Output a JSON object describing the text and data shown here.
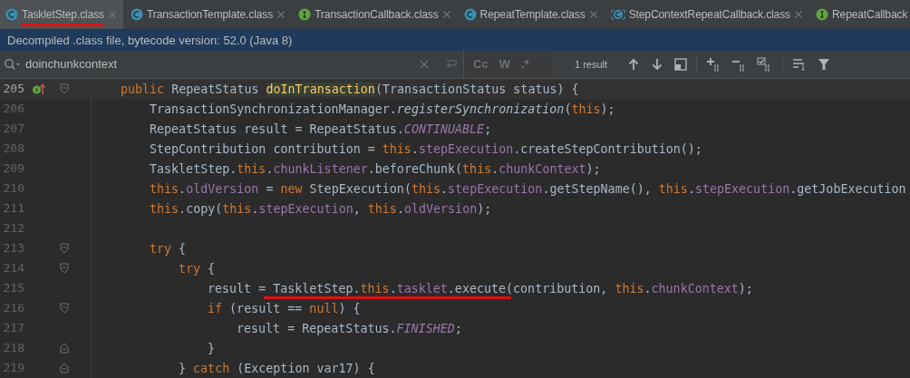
{
  "tabs": [
    {
      "label": "TaskletStep.class",
      "kind": "class",
      "selected": true,
      "marked": true,
      "closable": true
    },
    {
      "label": "TransactionTemplate.class",
      "kind": "class",
      "selected": false,
      "marked": false,
      "closable": true
    },
    {
      "label": "TransactionCallback.class",
      "kind": "interface",
      "selected": false,
      "marked": false,
      "closable": true
    },
    {
      "label": "RepeatTemplate.class",
      "kind": "class",
      "selected": false,
      "marked": false,
      "closable": true
    },
    {
      "label": "StepContextRepeatCallback.class",
      "kind": "bracketed",
      "selected": false,
      "marked": false,
      "closable": true
    },
    {
      "label": "RepeatCallback",
      "kind": "interface",
      "selected": false,
      "marked": false,
      "closable": false
    }
  ],
  "banner": "Decompiled .class file, bytecode version: 52.0 (Java 8)",
  "search": {
    "value": "doinchunkcontext",
    "options": [
      "Cc",
      "W",
      ".*"
    ],
    "result": "1 result"
  },
  "code_lines": [
    {
      "number": "205",
      "current": true,
      "implementation_marker": true,
      "fold_start": true,
      "fold_end": false,
      "tokens": [
        {
          "kind": "keyword",
          "text": "public"
        },
        {
          "kind": "plain",
          "text": " RepeatStatus "
        },
        {
          "kind": "declaration",
          "text": "doInTransaction"
        },
        {
          "kind": "plain",
          "text": "(TransactionStatus status) {"
        }
      ],
      "children": [
        {
          "number": "206",
          "current": false,
          "implementation_marker": false,
          "fold_start": false,
          "fold_end": false,
          "tokens": [
            {
              "kind": "plain",
              "text": "TransactionSynchronizationManager."
            },
            {
              "kind": "static-method",
              "text": "registerSynchronization"
            },
            {
              "kind": "plain",
              "text": "("
            },
            {
              "kind": "keyword",
              "text": "this"
            },
            {
              "kind": "plain",
              "text": ");"
            }
          ]
        },
        {
          "number": "207",
          "current": false,
          "implementation_marker": false,
          "fold_start": false,
          "fold_end": false,
          "tokens": [
            {
              "kind": "plain",
              "text": "RepeatStatus result = RepeatStatus."
            },
            {
              "kind": "static",
              "text": "CONTINUABLE"
            },
            {
              "kind": "plain",
              "text": ";"
            }
          ]
        },
        {
          "number": "208",
          "current": false,
          "implementation_marker": false,
          "fold_start": false,
          "fold_end": false,
          "tokens": [
            {
              "kind": "plain",
              "text": "StepContribution contribution = "
            },
            {
              "kind": "keyword",
              "text": "this"
            },
            {
              "kind": "member",
              "text": ".stepExecution"
            },
            {
              "kind": "plain",
              "text": ".createStepContribution();"
            }
          ]
        },
        {
          "number": "209",
          "current": false,
          "implementation_marker": false,
          "fold_start": false,
          "fold_end": false,
          "tokens": [
            {
              "kind": "plain",
              "text": "TaskletStep."
            },
            {
              "kind": "keyword",
              "text": "this"
            },
            {
              "kind": "member",
              "text": ".chunkListener"
            },
            {
              "kind": "plain",
              "text": ".beforeChunk("
            },
            {
              "kind": "keyword",
              "text": "this"
            },
            {
              "kind": "member",
              "text": ".chunkContext"
            },
            {
              "kind": "plain",
              "text": ");"
            }
          ]
        },
        {
          "number": "210",
          "current": false,
          "implementation_marker": false,
          "fold_start": false,
          "fold_end": false,
          "tokens": [
            {
              "kind": "keyword",
              "text": "this"
            },
            {
              "kind": "member",
              "text": ".oldVersion"
            },
            {
              "kind": "plain",
              "text": " = "
            },
            {
              "kind": "keyword",
              "text": "new"
            },
            {
              "kind": "plain",
              "text": " StepExecution("
            },
            {
              "kind": "keyword",
              "text": "this"
            },
            {
              "kind": "member",
              "text": ".stepExecution"
            },
            {
              "kind": "plain",
              "text": ".getStepName(), "
            },
            {
              "kind": "keyword",
              "text": "this"
            },
            {
              "kind": "member",
              "text": ".stepExecution"
            },
            {
              "kind": "plain",
              "text": ".getJobExecution"
            }
          ]
        },
        {
          "number": "211",
          "current": false,
          "implementation_marker": false,
          "fold_start": false,
          "fold_end": false,
          "tokens": [
            {
              "kind": "keyword",
              "text": "this"
            },
            {
              "kind": "plain",
              "text": ".copy("
            },
            {
              "kind": "keyword",
              "text": "this"
            },
            {
              "kind": "member",
              "text": ".stepExecution"
            },
            {
              "kind": "plain",
              "text": ", "
            },
            {
              "kind": "keyword",
              "text": "this"
            },
            {
              "kind": "member",
              "text": ".oldVersion"
            },
            {
              "kind": "plain",
              "text": ");"
            }
          ]
        },
        {
          "number": "212",
          "current": false,
          "implementation_marker": false,
          "fold_start": false,
          "fold_end": false
        },
        {
          "number": "213",
          "current": false,
          "implementation_marker": false,
          "fold_start": true,
          "fold_end": false,
          "tokens": [
            {
              "kind": "keyword",
              "text": "try"
            },
            {
              "kind": "plain",
              "text": " {"
            }
          ],
          "children": [
            {
              "number": "214",
              "current": false,
              "implementation_marker": false,
              "fold_start": true,
              "fold_end": false,
              "tokens": [
                {
                  "kind": "keyword",
                  "text": "try"
                },
                {
                  "kind": "plain",
                  "text": " {"
                }
              ],
              "children": [
                {
                  "number": "215",
                  "current": false,
                  "implementation_marker": false,
                  "fold_start": false,
                  "fold_end": false,
                  "tokens": [
                    {
                      "kind": "plain",
                      "text": "result = "
                    },
                    {
                      "kind": "plain",
                      "text": "TaskletStep.",
                      "marked": true
                    },
                    {
                      "kind": "keyword",
                      "text": "this",
                      "marked": true
                    },
                    {
                      "kind": "member",
                      "text": ".tasklet",
                      "marked": true
                    },
                    {
                      "kind": "plain",
                      "text": ".execute",
                      "marked": true
                    },
                    {
                      "kind": "plain",
                      "text": "(contribution, "
                    },
                    {
                      "kind": "keyword",
                      "text": "this"
                    },
                    {
                      "kind": "member",
                      "text": ".chunkContext"
                    },
                    {
                      "kind": "plain",
                      "text": ");"
                    }
                  ]
                },
                {
                  "number": "216",
                  "current": false,
                  "implementation_marker": false,
                  "fold_start": true,
                  "fold_end": false,
                  "tokens": [
                    {
                      "kind": "keyword",
                      "text": "if"
                    },
                    {
                      "kind": "plain",
                      "text": " (result == "
                    },
                    {
                      "kind": "keyword",
                      "text": "null"
                    },
                    {
                      "kind": "plain",
                      "text": ") {"
                    }
                  ],
                  "children": [
                    {
                      "number": "217",
                      "current": false,
                      "implementation_marker": false,
                      "fold_start": false,
                      "fold_end": false,
                      "tokens": [
                        {
                          "kind": "plain",
                          "text": "result = RepeatStatus."
                        },
                        {
                          "kind": "static",
                          "text": "FINISHED"
                        },
                        {
                          "kind": "plain",
                          "text": ";"
                        }
                      ]
                    }
                  ]
                },
                {
                  "number": "218",
                  "current": false,
                  "implementation_marker": false,
                  "fold_start": false,
                  "fold_end": true,
                  "tokens": [
                    {
                      "kind": "plain",
                      "text": "}"
                    }
                  ]
                }
              ]
            },
            {
              "number": "219",
              "current": false,
              "implementation_marker": false,
              "fold_start": false,
              "fold_end": true,
              "tokens": [
                {
                  "kind": "plain",
                  "text": "} "
                },
                {
                  "kind": "keyword",
                  "text": "catch"
                },
                {
                  "kind": "plain",
                  "text": " (Exception var17) {"
                }
              ]
            }
          ]
        }
      ]
    }
  ]
}
